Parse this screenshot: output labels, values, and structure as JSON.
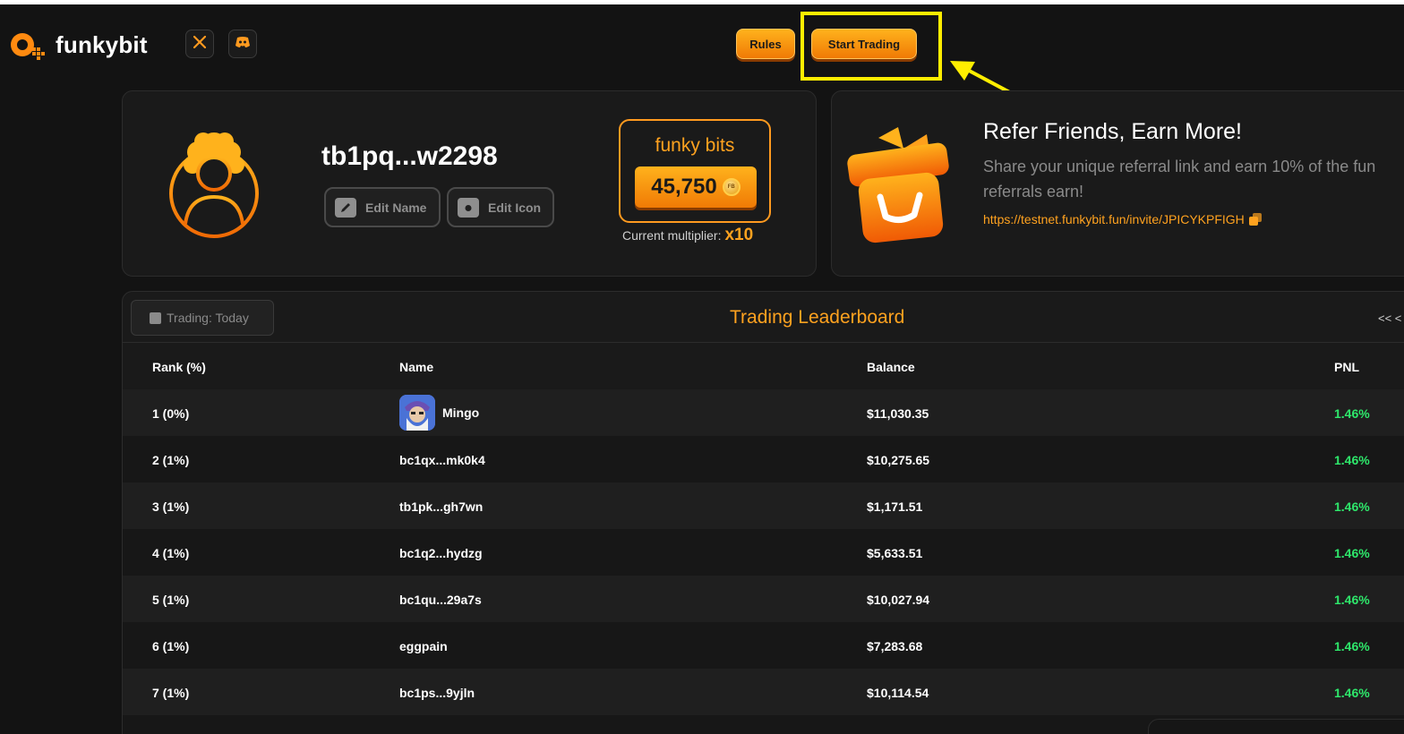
{
  "header": {
    "brand": "funkybit",
    "rules_label": "Rules",
    "start_trading_label": "Start Trading"
  },
  "profile": {
    "username": "tb1pq...w2298",
    "edit_name_label": "Edit Name",
    "edit_icon_label": "Edit Icon",
    "bits_title": "funky bits",
    "bits_amount": "45,750",
    "coin_symbol": "FB",
    "multiplier_label": "Current multiplier:",
    "multiplier_value": "x10"
  },
  "referral": {
    "title": "Refer Friends, Earn More!",
    "description_line1": "Share your unique referral link and earn 10% of the fun",
    "description_line2": "referrals earn!",
    "link": "https://testnet.funkybit.fun/invite/JPICYKPFIGH"
  },
  "leaderboard": {
    "filter_label": "Trading: Today",
    "title": "Trading Leaderboard",
    "pager": "<<  <",
    "columns": [
      "Rank (%)",
      "Name",
      "Balance",
      "PNL"
    ],
    "rows": [
      {
        "rank": "1 (0%)",
        "name": "Mingo",
        "balance": "$11,030.35",
        "pnl": "1.46%"
      },
      {
        "rank": "2 (1%)",
        "name": "bc1qx...mk0k4",
        "balance": "$10,275.65",
        "pnl": "1.46%"
      },
      {
        "rank": "3 (1%)",
        "name": "tb1pk...gh7wn",
        "balance": "$1,171.51",
        "pnl": "1.46%"
      },
      {
        "rank": "4 (1%)",
        "name": "bc1q2...hydzg",
        "balance": "$5,633.51",
        "pnl": "1.46%"
      },
      {
        "rank": "5 (1%)",
        "name": "bc1qu...29a7s",
        "balance": "$10,027.94",
        "pnl": "1.46%"
      },
      {
        "rank": "6 (1%)",
        "name": "eggpain",
        "balance": "$7,283.68",
        "pnl": "1.46%"
      },
      {
        "rank": "7 (1%)",
        "name": "bc1ps...9yjln",
        "balance": "$10,114.54",
        "pnl": "1.46%"
      }
    ]
  },
  "colors": {
    "accent": "#ffa21f",
    "highlight": "#ffee00",
    "pnl_positive": "#2ee86b",
    "background": "#131313"
  },
  "icons": [
    "funkybit-logo-icon",
    "x-twitter-icon",
    "discord-icon",
    "pencil-icon",
    "camera-icon",
    "coin-icon",
    "gift-icon",
    "copy-icon",
    "calendar-icon",
    "avatar-icon"
  ]
}
